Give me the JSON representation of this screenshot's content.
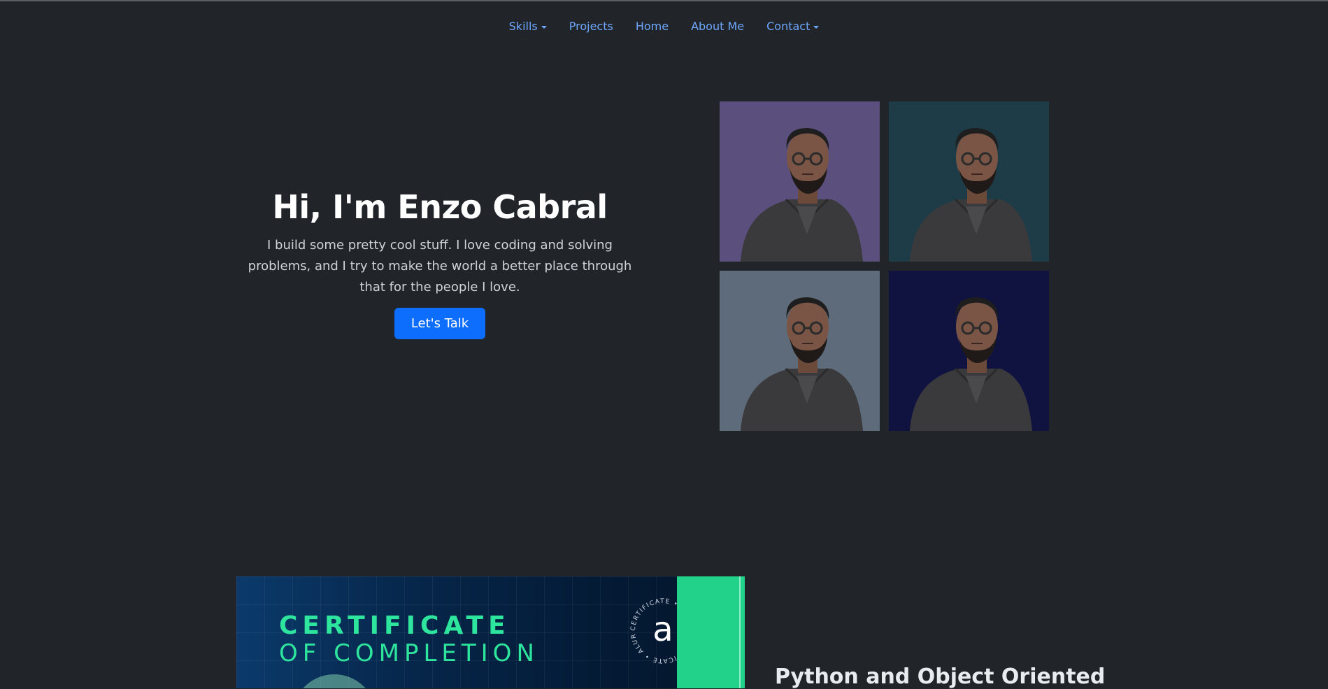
{
  "nav": {
    "items": [
      {
        "label": "Skills",
        "dropdown": true
      },
      {
        "label": "Projects",
        "dropdown": false
      },
      {
        "label": "Home",
        "dropdown": false
      },
      {
        "label": "About Me",
        "dropdown": false
      },
      {
        "label": "Contact",
        "dropdown": true
      }
    ]
  },
  "hero": {
    "title": "Hi, I'm Enzo Cabral",
    "subtitle": "I build some pretty cool stuff. I love coding and solving problems, and I try to make the world a better place through that for the people I love.",
    "cta_label": "Let's Talk"
  },
  "avatars": {
    "backgrounds": [
      "#5b507d",
      "#1e3b48",
      "#5e6b7b",
      "#101340"
    ]
  },
  "certificate": {
    "line1": "CERTIFICATE",
    "line2": "OF COMPLETION",
    "seal_letter": "a",
    "seal_ring": "CERTIFICATE • ALURA CERTIFICATE • ALURA"
  },
  "project": {
    "title": "Python and Object Oriented"
  },
  "colors": {
    "background": "#212529",
    "link": "#6ea8fe",
    "primary": "#0d6efd",
    "cert_green": "#23d28a"
  }
}
